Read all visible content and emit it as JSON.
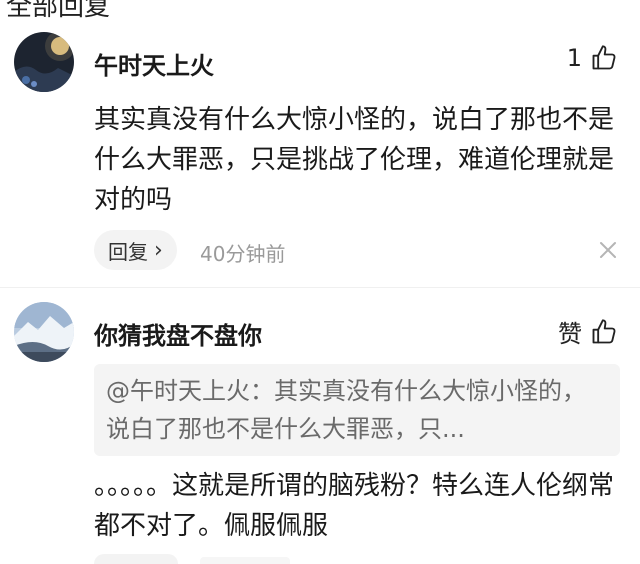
{
  "section": {
    "header": "全部回复"
  },
  "comments": [
    {
      "username": "午时天上火",
      "like_count": "1",
      "like_icon": "thumbs-up-icon",
      "body": "其实真没有什么大惊小怪的，说白了那也不是什么大罪恶，只是挑战了伦理，难道伦理就是对的吗",
      "reply_label": "回复",
      "reply_chevron": "›",
      "timestamp": "40分钟前",
      "dismiss_icon": "close-icon"
    },
    {
      "username": "你猜我盘不盘你",
      "like_label": "赞",
      "like_icon": "thumbs-up-icon",
      "quote": "@午时天上火：其实真没有什么大惊小怪的，说白了那也不是什么大罪恶，只...",
      "body": "。。。。。这就是所谓的脑残粉？特么连人伦纲常都不对了。佩服佩服"
    }
  ]
}
